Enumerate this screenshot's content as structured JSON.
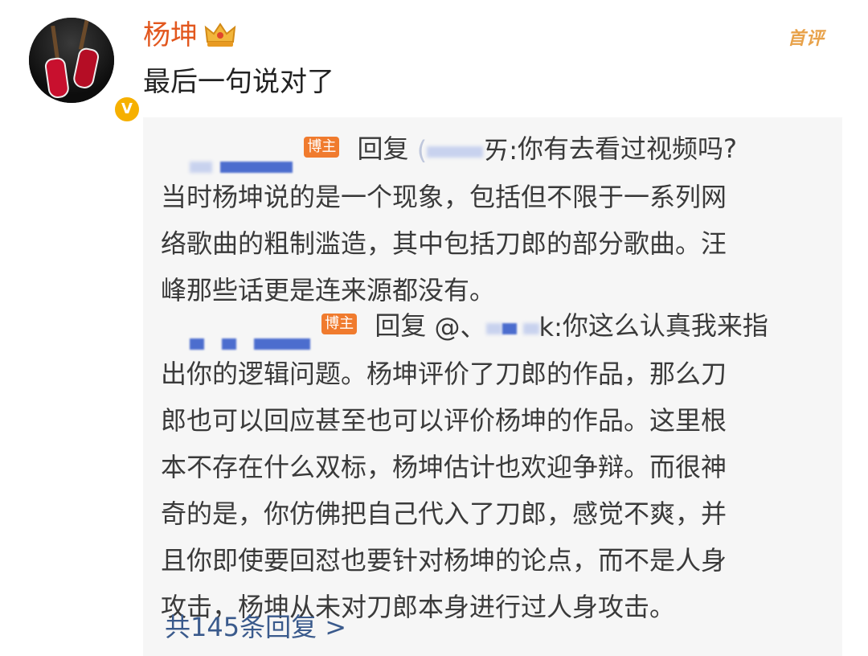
{
  "comment": {
    "username": "杨坤",
    "badge_label": "首评",
    "text": "最后一句说对了",
    "avatar_verified_mark": "V"
  },
  "replies": [
    {
      "host_tag": "博主",
      "reply_word": "回复",
      "mention_prefix": "(",
      "mention_suffix": "ㄞ:",
      "lines": [
        "你有去看过视频吗?",
        "当时杨坤说的是一个现象，包括但不限于一系列网",
        "络歌曲的粗制滥造，其中包括刀郎的部分歌曲。汪",
        "峰那些话更是连来源都没有。"
      ]
    },
    {
      "host_tag": "博主",
      "reply_word": "回复",
      "mention_prefix": "@、",
      "mention_suffix": "k:",
      "lines": [
        "你这么认真我来指",
        "出你的逻辑问题。杨坤评价了刀郎的作品，那么刀",
        "郎也可以回应甚至也可以评价杨坤的作品。这里根",
        "本不存在什么双标，杨坤估计也欢迎争辩。而很神",
        "奇的是，你仿佛把自己代入了刀郎，感觉不爽，并",
        "且你即使要回怼也要针对杨坤的论点，而不是人身",
        "攻击，杨坤从未对刀郎本身进行过人身攻击。"
      ]
    }
  ],
  "more_replies": "共145条回复 >",
  "colors": {
    "username": "#e2571e",
    "host_tag_bg": "#f07b2e",
    "link": "#3a5a8c",
    "reply_box_bg": "#f6f6f6"
  }
}
